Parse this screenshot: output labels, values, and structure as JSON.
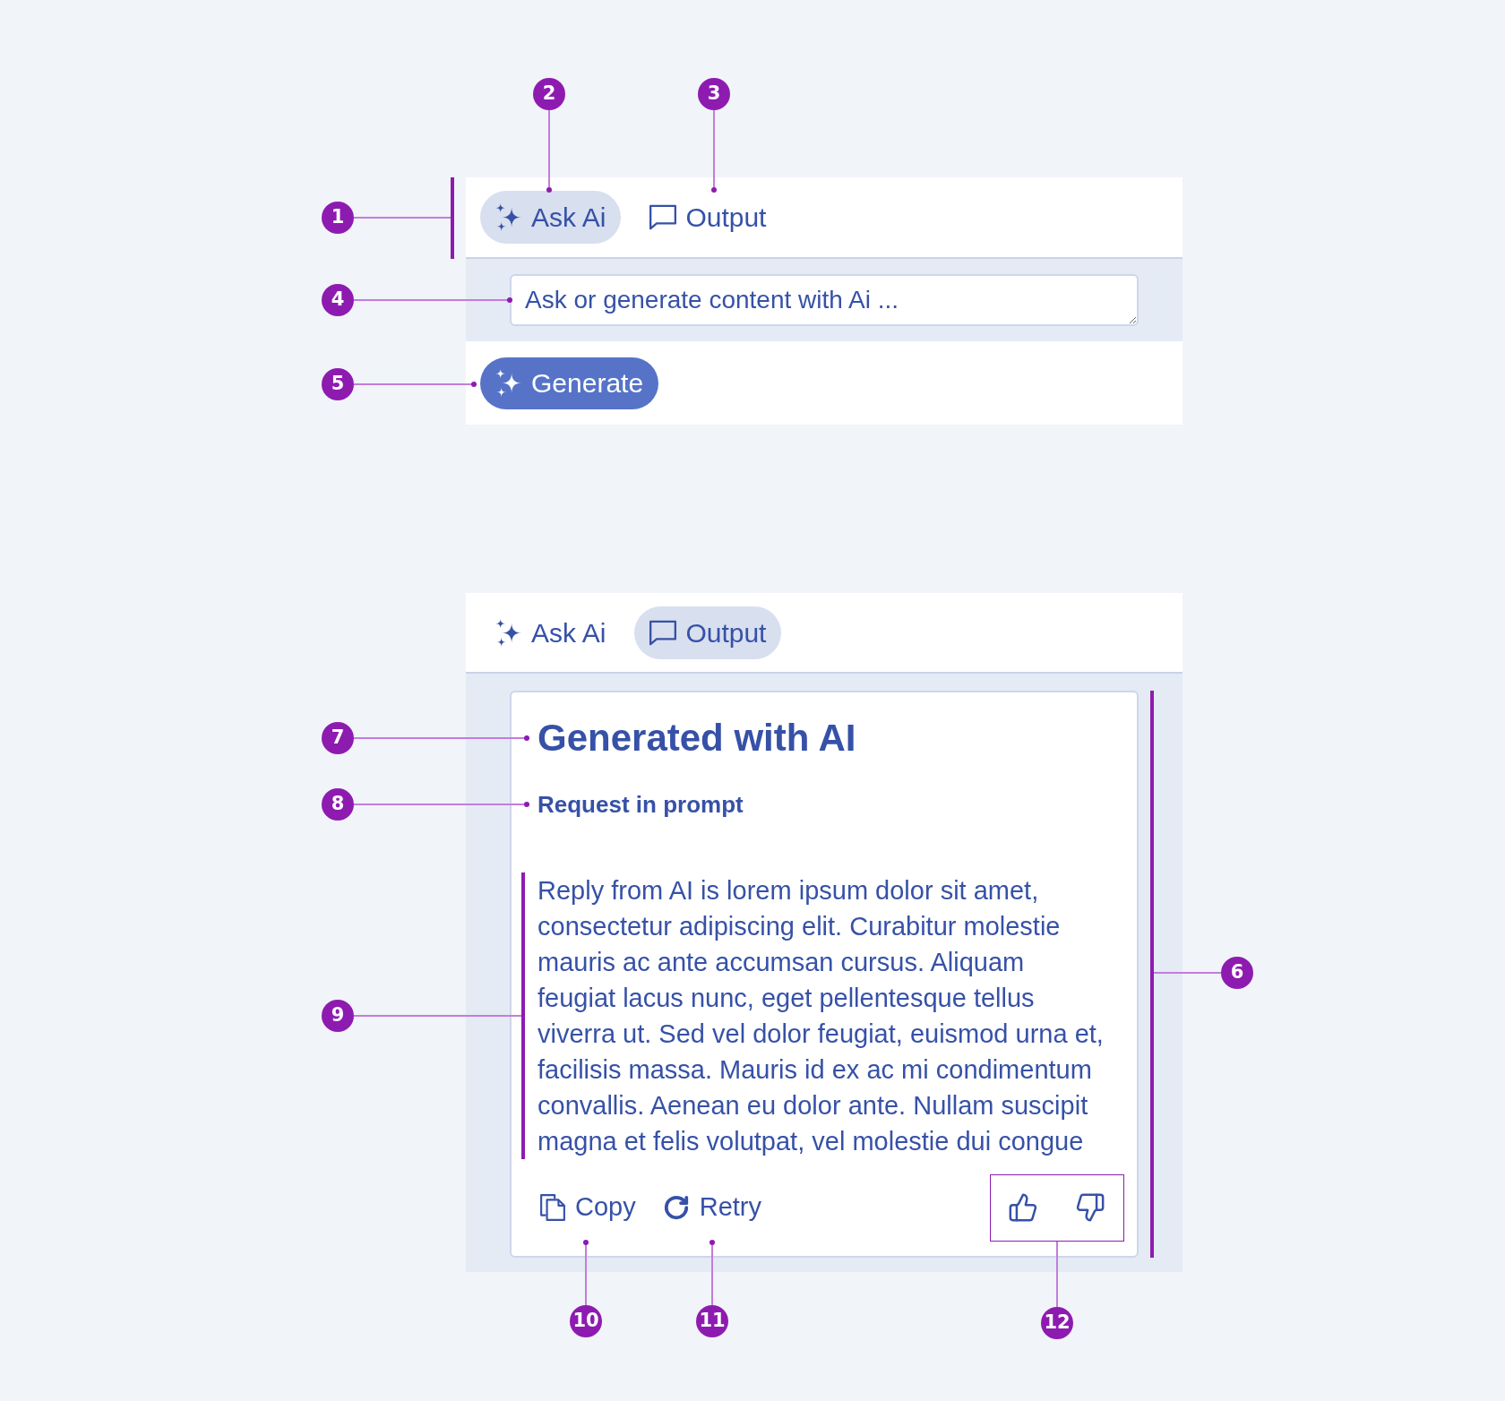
{
  "examples": [
    {
      "kind": "prompt",
      "tabs": [
        {
          "label": "Ask Ai",
          "selected": true
        },
        {
          "label": "Output",
          "selected": false
        }
      ],
      "prompt_field": {
        "placeholder": "Ask or generate content with Ai ..."
      },
      "generate_button": {
        "label": "Generate"
      }
    },
    {
      "kind": "output",
      "tabs": [
        {
          "label": "Ask Ai",
          "selected": false
        },
        {
          "label": "Output",
          "selected": true
        }
      ],
      "output_card": {
        "title": "Generated with AI",
        "subtitle": "Request in prompt",
        "reply": "Reply from AI is lorem ipsum dolor sit amet, consectetur adipiscing elit. Curabitur molestie mauris ac ante accumsan cursus. Aliquam feugiat lacus nunc, eget pellentesque tellus viverra ut. Sed vel dolor feugiat, euismod urna et, facilisis massa. Mauris id ex ac mi condimentum convallis. Aenean eu dolor ante. Nullam suscipit magna et felis volutpat, vel molestie dui congue",
        "actions": [
          {
            "label": "Copy"
          },
          {
            "label": "Retry"
          }
        ]
      }
    }
  ],
  "callouts": [
    "1",
    "2",
    "3",
    "4",
    "5",
    "6",
    "7",
    "8",
    "9",
    "10",
    "11",
    "12"
  ]
}
